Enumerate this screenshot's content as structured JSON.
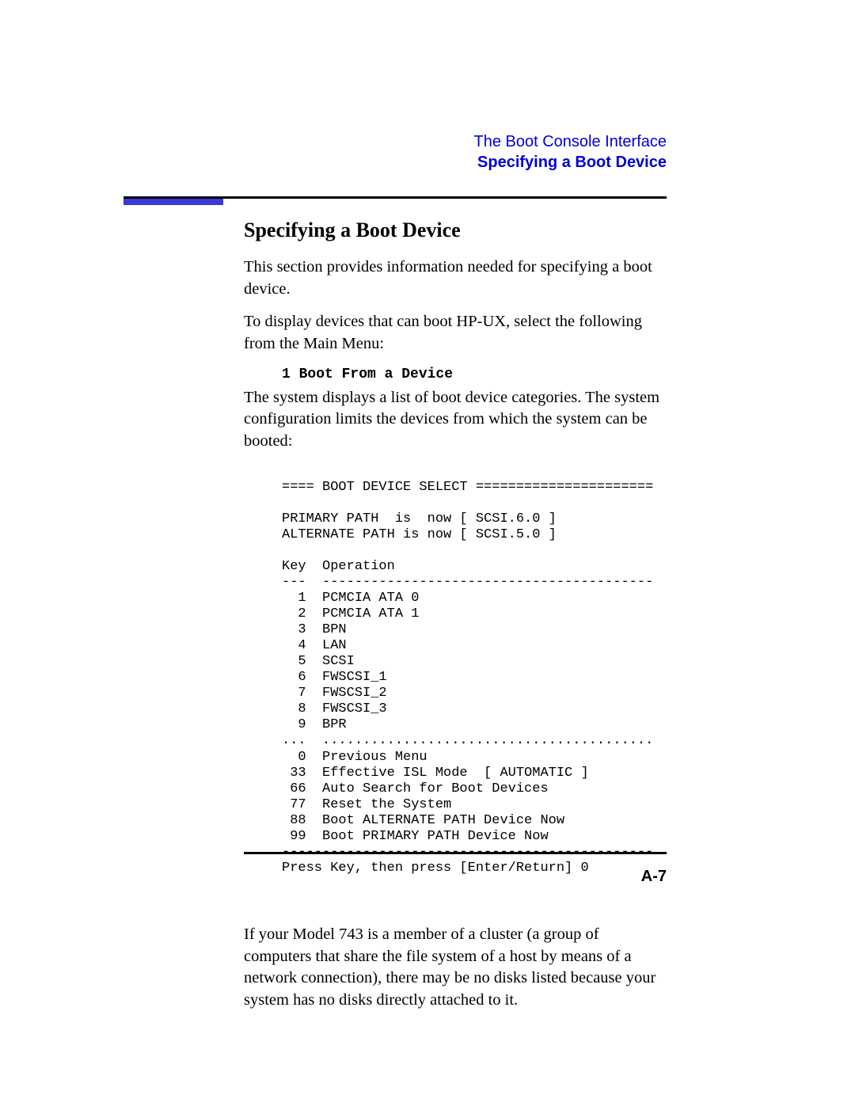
{
  "header": {
    "line1": "The Boot Console Interface",
    "line2": "Specifying a Boot Device"
  },
  "title": "Specifying a Boot Device",
  "para1": "This section provides information needed for specifying a boot device.",
  "para2": "To display devices that can boot HP-UX, select the following from the Main Menu:",
  "menu_line": "1 Boot From a Device",
  "para3": "The system displays a list of boot device categories. The system configuration limits the devices from which the system can be booted:",
  "console": "==== BOOT DEVICE SELECT ======================\n\nPRIMARY PATH  is  now [ SCSI.6.0 ]\nALTERNATE PATH is now [ SCSI.5.0 ]\n\nKey  Operation\n---  -----------------------------------------\n  1  PCMCIA ATA 0\n  2  PCMCIA ATA 1\n  3  BPN\n  4  LAN\n  5  SCSI\n  6  FWSCSI_1\n  7  FWSCSI_2\n  8  FWSCSI_3\n  9  BPR\n...  .........................................\n  0  Previous Menu\n 33  Effective ISL Mode  [ AUTOMATIC ]\n 66  Auto Search for Boot Devices\n 77  Reset the System\n 88  Boot ALTERNATE PATH Device Now\n 99  Boot PRIMARY PATH Device Now\n----------------------------------------------\nPress Key, then press [Enter/Return] 0",
  "para4": "If your Model 743 is a member of a cluster (a group of computers that share the file system of a host by means of a network connection), there may be no disks listed because your system has no disks directly attached to it.",
  "page_number": "A-7"
}
